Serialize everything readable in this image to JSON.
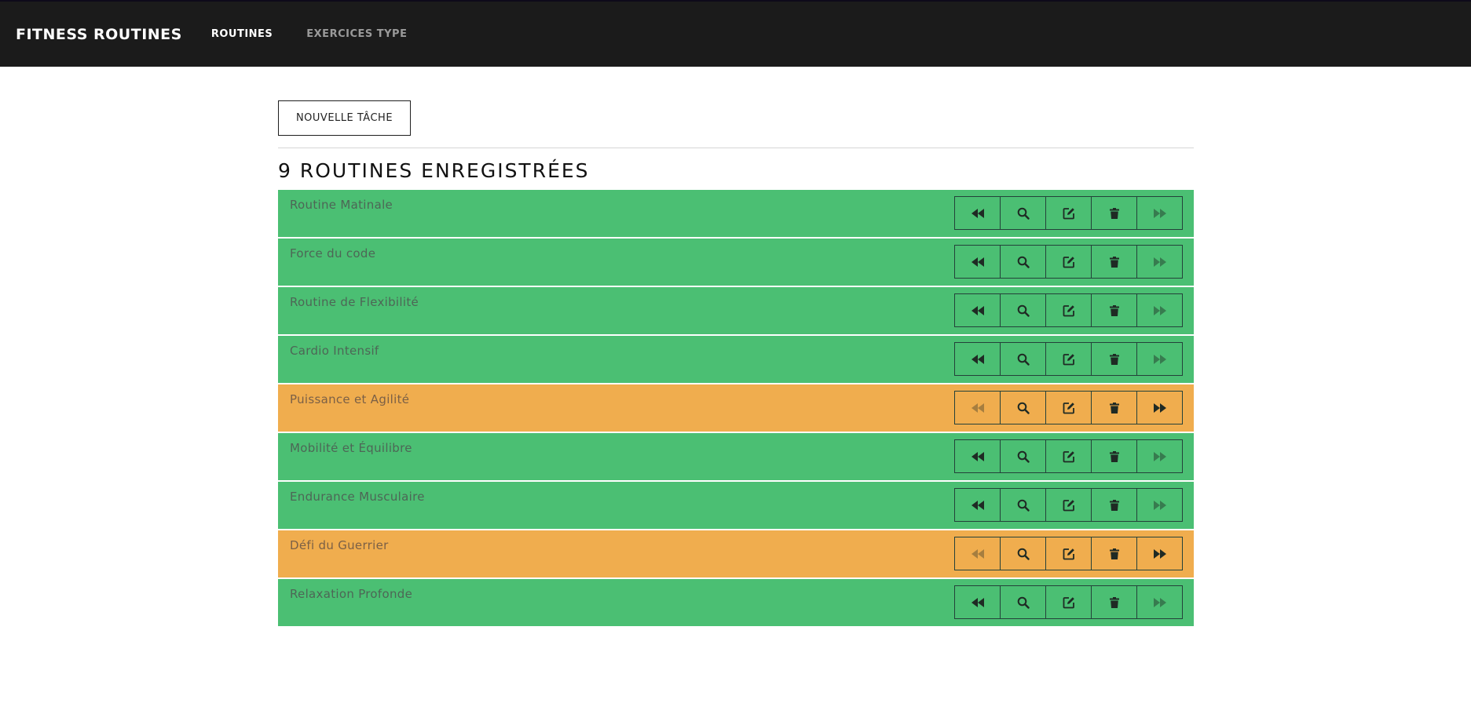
{
  "app": {
    "brand": "FITNESS ROUTINES",
    "nav": [
      {
        "label": "ROUTINES",
        "active": true
      },
      {
        "label": "EXERCICES TYPE",
        "active": false
      }
    ]
  },
  "toolbar": {
    "new_task_label": "NOUVELLE TÂCHE"
  },
  "list": {
    "heading": "9 ROUTINES ENREGISTRÉES",
    "items": [
      {
        "name": "Routine Matinale",
        "status": "green"
      },
      {
        "name": "Force du code",
        "status": "green"
      },
      {
        "name": "Routine de Flexibilité",
        "status": "green"
      },
      {
        "name": "Cardio Intensif",
        "status": "green"
      },
      {
        "name": "Puissance et Agilité",
        "status": "orange"
      },
      {
        "name": "Mobilité et Équilibre",
        "status": "green"
      },
      {
        "name": "Endurance Musculaire",
        "status": "green"
      },
      {
        "name": "Défi du Guerrier",
        "status": "orange"
      },
      {
        "name": "Relaxation Profonde",
        "status": "green"
      }
    ],
    "actions": [
      "backward-icon",
      "search-icon",
      "edit-icon",
      "trash-icon",
      "forward-icon"
    ]
  },
  "colors": {
    "green": "#4bbf73",
    "orange": "#f0ad4e",
    "navbar": "#1b1b1b"
  }
}
